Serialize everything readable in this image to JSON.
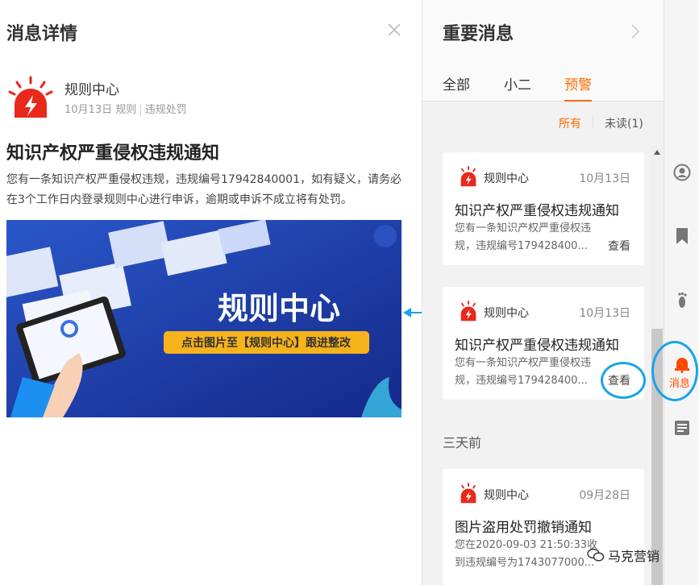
{
  "detail": {
    "title": "消息详情",
    "sender": {
      "name": "规则中心",
      "date": "10月13日",
      "category": "规则",
      "subcategory": "违规处罚"
    },
    "headline": "知识产权严重侵权违规通知",
    "body": "您有一条知识产权严重侵权违规，违规编号17942840001，如有疑义，请务必在3个工作日内登录规则中心进行申诉，逾期或申诉不成立将有处罚。",
    "banner": {
      "title": "规则中心",
      "subtitle": "点击图片至【规则中心】跟进整改"
    }
  },
  "panel": {
    "title": "重要消息",
    "tabs": [
      {
        "label": "全部"
      },
      {
        "label": "小二"
      },
      {
        "label": "预警"
      }
    ],
    "filters": {
      "all": "所有",
      "unread": "未读(1)"
    },
    "cards": [
      {
        "sender": "规则中心",
        "date": "10月13日",
        "title": "知识产权严重侵权违规通知",
        "text": "您有一条知识产权严重侵权违规，违规编号179428400...",
        "view": "查看"
      },
      {
        "sender": "规则中心",
        "date": "10月13日",
        "title": "知识产权严重侵权违规通知",
        "text": "您有一条知识产权严重侵权违规，违规编号179428400...",
        "view": "查看"
      },
      {
        "sender": "规则中心",
        "date": "09月28日",
        "title": "图片盗用处罚撤销通知",
        "text": "您在2020-09-03 21:50:33收到违规编号为1743077000..."
      }
    ],
    "section_label": "三天前"
  },
  "sidebar": {
    "active_label": "消息"
  },
  "watermark": "马克营销",
  "colors": {
    "accent": "#ff6a00",
    "alert_red": "#e8291c",
    "banner_blue": "#1b3a9a",
    "highlight": "#1aa3e8"
  },
  "icons": [
    "close-icon",
    "chevron-right-icon",
    "siren-logo-icon",
    "user-circle-icon",
    "bookmark-icon",
    "footprint-icon",
    "bell-icon",
    "document-icon",
    "wechat-icon"
  ]
}
